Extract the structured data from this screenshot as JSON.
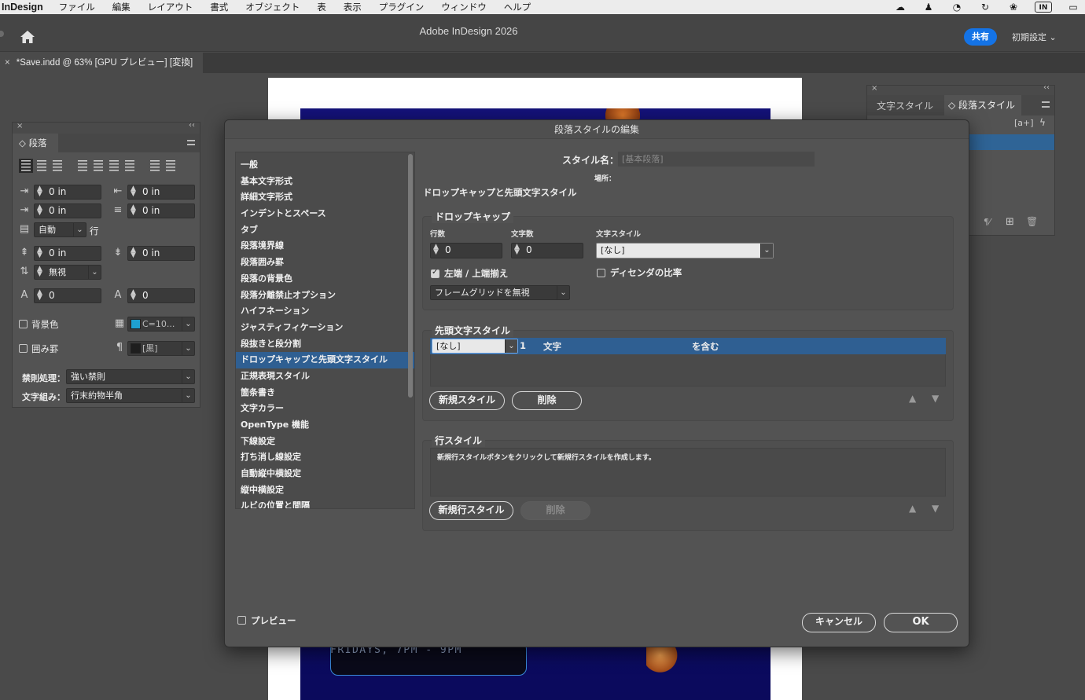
{
  "menubar": {
    "app": "InDesign",
    "items": [
      "ファイル",
      "編集",
      "レイアウト",
      "書式",
      "オブジェクト",
      "表",
      "表示",
      "プラグイン",
      "ウィンドウ",
      "ヘルプ"
    ],
    "tray_in_label": "IN"
  },
  "appbar": {
    "title": "Adobe InDesign 2026",
    "share": "共有",
    "workspace": "初期設定"
  },
  "document_tab": {
    "label": "*Save.indd @ 63% [GPU プレビュー] [変換]"
  },
  "artwork": {
    "event_text": "FRIDAYS, 7PM - 9PM"
  },
  "paragraph_panel": {
    "title": "段落",
    "left_indent": "0 in",
    "right_indent": "0 in",
    "first_line_indent": "0 in",
    "last_line_indent": "0 in",
    "align_to_grid": "自動",
    "align_unit": "行",
    "space_before": "0 in",
    "space_after": "0 in",
    "space_between": "無視",
    "drop_cap_lines": "0",
    "drop_cap_chars": "0",
    "shading_label": "背景色",
    "shading_color": "C=10...",
    "border_label": "囲み罫",
    "border_color": "[黒]",
    "kinsoku_label": "禁則処理：",
    "kinsoku_value": "強い禁則",
    "mojikumi_label": "文字組み：",
    "mojikumi_value": "行末約物半角"
  },
  "styles_panel": {
    "tab_char": "文字スタイル",
    "tab_para": "段落スタイル"
  },
  "dialog": {
    "title": "段落スタイルの編集",
    "categories": [
      "一般",
      "基本文字形式",
      "詳細文字形式",
      "インデントとスペース",
      "タブ",
      "段落境界線",
      "段落囲み罫",
      "段落の背景色",
      "段落分離禁止オプション",
      "ハイフネーション",
      "ジャスティフィケーション",
      "段抜きと段分割",
      "ドロップキャップと先頭文字スタイル",
      "正規表現スタイル",
      "箇条書き",
      "文字カラー",
      "OpenType 機能",
      "下線設定",
      "打ち消し線設定",
      "自動縦中横設定",
      "縦中横設定",
      "ルビの位置と間隔"
    ],
    "selected_category_index": 12,
    "style_name_label": "スタイル名：",
    "style_name_value": "[基本段落]",
    "location_label": "場所：",
    "section_heading": "ドロップキャップと先頭文字スタイル",
    "dropcap": {
      "legend": "ドロップキャップ",
      "lines_label": "行数",
      "chars_label": "文字数",
      "charstyle_label": "文字スタイル",
      "lines": "0",
      "chars": "0",
      "charstyle": "[なし]",
      "align_left_label": "左端 / 上端揃え",
      "align_left_checked": true,
      "descender_label": "ディセンダの比率",
      "descender_checked": false,
      "grid_option": "フレームグリッドを無視"
    },
    "nested": {
      "legend": "先頭文字スタイル",
      "row_style": "[なし]",
      "row_count": "1",
      "row_unit": "文字",
      "row_include": "を含む",
      "new_button": "新規スタイル",
      "delete_button": "削除"
    },
    "line_styles": {
      "legend": "行スタイル",
      "hint": "新規行スタイルボタンをクリックして新規行スタイルを作成します。",
      "new_button": "新規行スタイル",
      "delete_button": "削除"
    },
    "preview_label": "プレビュー",
    "cancel": "キャンセル",
    "ok": "OK"
  }
}
